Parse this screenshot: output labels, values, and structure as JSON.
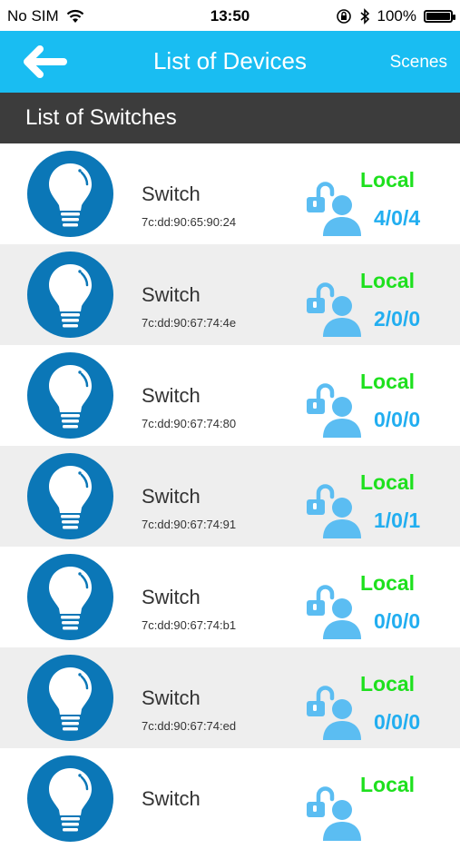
{
  "status_bar": {
    "carrier": "No SIM",
    "time": "13:50",
    "battery": "100%",
    "battery_fraction": 1.0
  },
  "nav": {
    "title": "List of Devices",
    "right_button": "Scenes",
    "back_icon": "arrow-left-icon"
  },
  "section_title": "List of Switches",
  "colors": {
    "nav_bg": "#19bdf2",
    "header_bg": "#3c3c3c",
    "icon_circle": "#0b77b7",
    "local_green": "#1ee01e",
    "count_blue": "#22aef0",
    "lock_user_blue": "#5bbdf2"
  },
  "devices": [
    {
      "name": "Switch",
      "mac": "7c:dd:90:65:90:24",
      "mode": "Local",
      "counts": "4/0/4"
    },
    {
      "name": "Switch",
      "mac": "7c:dd:90:67:74:4e",
      "mode": "Local",
      "counts": "2/0/0"
    },
    {
      "name": "Switch",
      "mac": "7c:dd:90:67:74:80",
      "mode": "Local",
      "counts": "0/0/0"
    },
    {
      "name": "Switch",
      "mac": "7c:dd:90:67:74:91",
      "mode": "Local",
      "counts": "1/0/1"
    },
    {
      "name": "Switch",
      "mac": "7c:dd:90:67:74:b1",
      "mode": "Local",
      "counts": "0/0/0"
    },
    {
      "name": "Switch",
      "mac": "7c:dd:90:67:74:ed",
      "mode": "Local",
      "counts": "0/0/0"
    },
    {
      "name": "Switch",
      "mac": "",
      "mode": "Local",
      "counts": ""
    }
  ]
}
